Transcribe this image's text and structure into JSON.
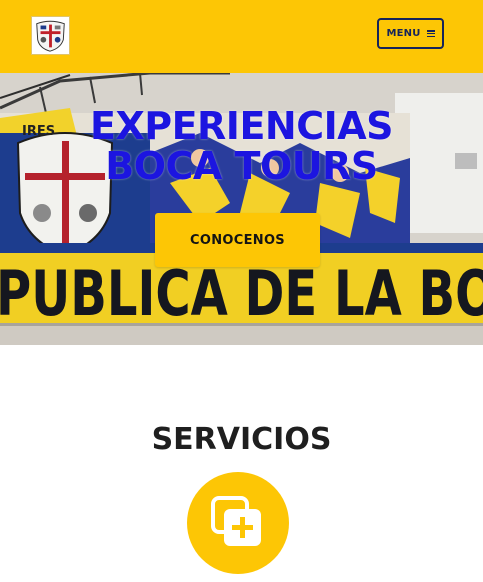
{
  "header": {
    "logo_icon": "shield-crest-icon",
    "menu_label": "MENU",
    "menu_icon": "hamburger-icon"
  },
  "hero": {
    "title_line1": "EXPERIENCIAS",
    "title_line2": "BOCA TOURS",
    "cta_label": "CONOCENOS",
    "mural_text": "PUBLICA DE LA BO",
    "mural_text_small": "IRES"
  },
  "services": {
    "title": "SERVICIOS",
    "icon": "plus-copy-icon"
  },
  "colors": {
    "brand_yellow": "#fdc605",
    "title_blue": "#1c15e0",
    "menu_navy": "#16235a",
    "text_dark": "#1f1f1f"
  }
}
